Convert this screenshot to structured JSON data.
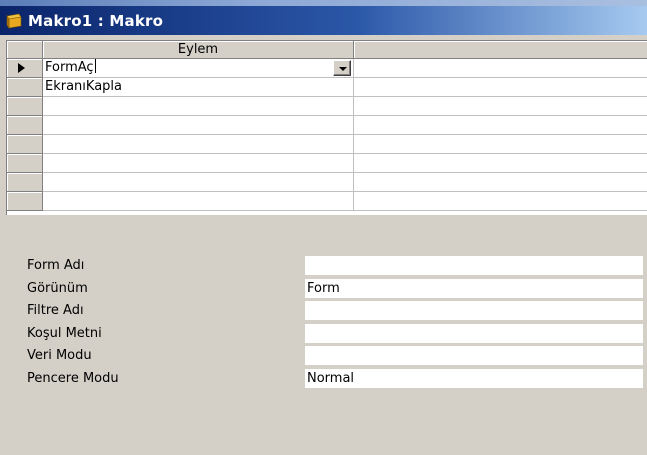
{
  "window": {
    "title": "Makro1 : Makro",
    "icon": "macro-icon"
  },
  "grid": {
    "column_header": "Eylem",
    "rows": [
      {
        "action": "FormAç",
        "active": true
      },
      {
        "action": "EkranıKapla",
        "active": false
      },
      {
        "action": "",
        "active": false
      },
      {
        "action": "",
        "active": false
      },
      {
        "action": "",
        "active": false
      },
      {
        "action": "",
        "active": false
      },
      {
        "action": "",
        "active": false
      },
      {
        "action": "",
        "active": false
      }
    ]
  },
  "properties": [
    {
      "label": "Form Adı",
      "value": ""
    },
    {
      "label": "Görünüm",
      "value": "Form"
    },
    {
      "label": "Filtre Adı",
      "value": ""
    },
    {
      "label": "Koşul Metni",
      "value": ""
    },
    {
      "label": "Veri Modu",
      "value": ""
    },
    {
      "label": "Pencere Modu",
      "value": "Normal"
    }
  ]
}
